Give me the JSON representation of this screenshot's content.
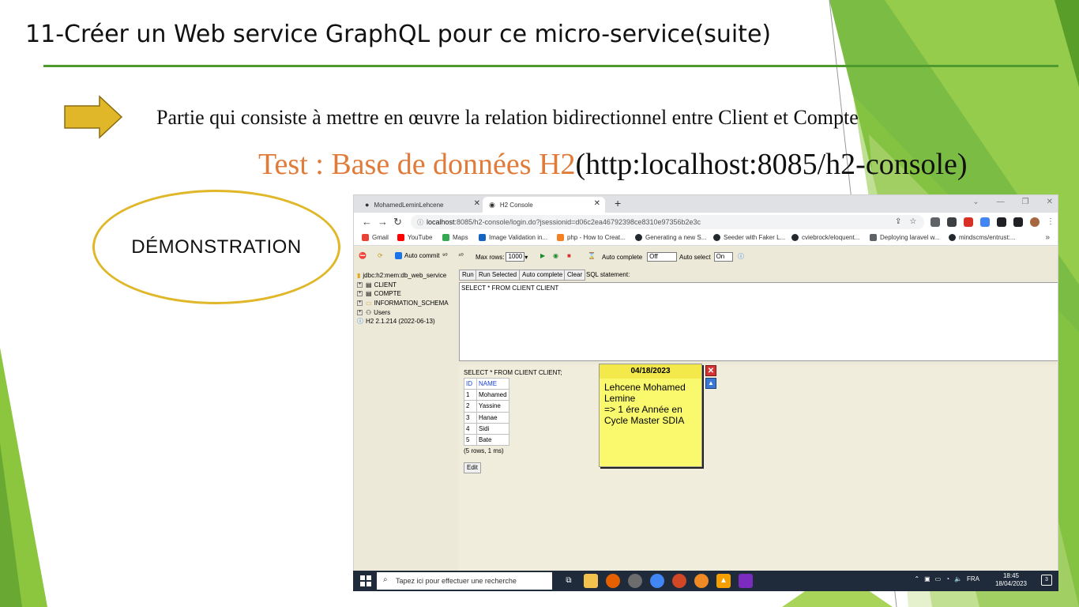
{
  "slide": {
    "title_num": "11",
    "title_rest": "-Créer un Web service GraphQL pour ce micro-service(suite)",
    "subtitle": "Partie qui consiste à mettre en œuvre la relation bidirectionnel entre Client et Compte",
    "test_orange": "Test : Base de données H2",
    "test_black": "(http:localhost:8085/h2-console)",
    "demo_label": "DÉMONSTRATION",
    "colors": {
      "accent_green": "#4e9a2e",
      "arrow_gold": "#e0b728",
      "test_orange": "#e07b39"
    }
  },
  "browser": {
    "tabs": [
      {
        "label": "MohamedLeminLehcene",
        "icon": "github-icon"
      },
      {
        "label": "H2 Console",
        "icon": "h2-icon"
      }
    ],
    "new_tab": "+",
    "url_host": "localhost",
    "url_rest": ":8085/h2-console/login.do?jsessionid=d06c2ea46792398ce8310e97356b2e3c",
    "bookmarks": [
      "Gmail",
      "YouTube",
      "Maps",
      "Image Validation in...",
      "php - How to Creat...",
      "Generating a new S...",
      "Seeder with Faker L...",
      "cviebrock/eloquent...",
      "Deploying laravel w...",
      "mindscms/entrust:..."
    ],
    "bookmarks_more": "»"
  },
  "h2": {
    "auto_commit": "Auto commit",
    "max_rows_label": "Max rows:",
    "max_rows_value": "1000",
    "auto_complete_label": "Auto complete",
    "auto_complete_value": "Off",
    "auto_select_label": "Auto select",
    "auto_select_value": "On",
    "tree": {
      "connection": "jdbc:h2:mem:db_web_service",
      "items": [
        "CLIENT",
        "COMPTE",
        "INFORMATION_SCHEMA",
        "Users"
      ],
      "version": "H2 2.1.214 (2022-06-13)"
    },
    "buttons": {
      "run": "Run",
      "run_selected": "Run Selected",
      "auto_complete": "Auto complete",
      "clear": "Clear"
    },
    "sql_label": "SQL statement:",
    "sql_text": "SELECT * FROM CLIENT CLIENT",
    "result_title": "SELECT * FROM CLIENT CLIENT;",
    "columns": [
      "ID",
      "NAME"
    ],
    "rows": [
      [
        "1",
        "Mohamed"
      ],
      [
        "2",
        "Yassine"
      ],
      [
        "3",
        "Hanae"
      ],
      [
        "4",
        "Sidi"
      ],
      [
        "5",
        "Bate"
      ]
    ],
    "rows_info": "(5 rows, 1 ms)",
    "edit": "Edit"
  },
  "sticky": {
    "date": "04/18/2023",
    "lines": [
      "Lehcene Mohamed",
      "Lemine",
      "=> 1 ére Année en",
      "Cycle Master SDIA"
    ]
  },
  "taskbar": {
    "search_placeholder": "Tapez ici pour effectuer une recherche",
    "lang": "FRA",
    "time": "18:45",
    "date": "18/04/2023",
    "notif_count": "3"
  }
}
